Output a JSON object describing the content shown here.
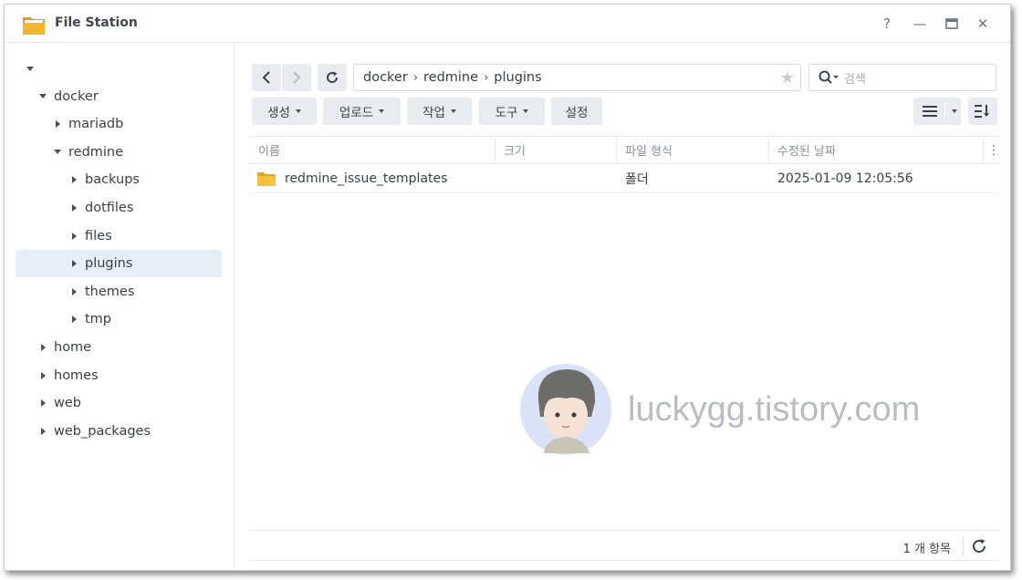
{
  "window": {
    "title": "File Station"
  },
  "titlebar": {
    "help": "?",
    "minimize": "—",
    "close": "✕"
  },
  "sidebar": {
    "items": [
      {
        "label": "",
        "level": 0,
        "expanded": true
      },
      {
        "label": "docker",
        "level": 1,
        "expanded": true
      },
      {
        "label": "mariadb",
        "level": 2,
        "expanded": false
      },
      {
        "label": "redmine",
        "level": 2,
        "expanded": true
      },
      {
        "label": "backups",
        "level": 3,
        "expanded": false
      },
      {
        "label": "dotfiles",
        "level": 3,
        "expanded": false
      },
      {
        "label": "files",
        "level": 3,
        "expanded": false
      },
      {
        "label": "plugins",
        "level": 3,
        "expanded": false,
        "selected": true
      },
      {
        "label": "themes",
        "level": 3,
        "expanded": false
      },
      {
        "label": "tmp",
        "level": 3,
        "expanded": false
      },
      {
        "label": "home",
        "level": 1,
        "expanded": false
      },
      {
        "label": "homes",
        "level": 1,
        "expanded": false
      },
      {
        "label": "web",
        "level": 1,
        "expanded": false
      },
      {
        "label": "web_packages",
        "level": 1,
        "expanded": false
      }
    ]
  },
  "toolbar": {
    "path": [
      "docker",
      "redmine",
      "plugins"
    ],
    "path_sep": "›",
    "search_placeholder": "검색",
    "create": "생성",
    "upload": "업로드",
    "action": "작업",
    "tools": "도구",
    "settings": "설정"
  },
  "table": {
    "columns": [
      "이름",
      "크기",
      "파일 형식",
      "수정된 날짜"
    ],
    "rows": [
      {
        "name": "redmine_issue_templates",
        "size": "",
        "type": "폴더",
        "modified": "2025-01-09 12:05:56"
      }
    ]
  },
  "watermark": {
    "text": "luckygg.tistory.com"
  },
  "footer": {
    "count": "1 개 항목"
  },
  "colors": {
    "accent": "#3d7ed6",
    "folder": "#f5b72b",
    "selected_bg": "#e6eef8"
  }
}
